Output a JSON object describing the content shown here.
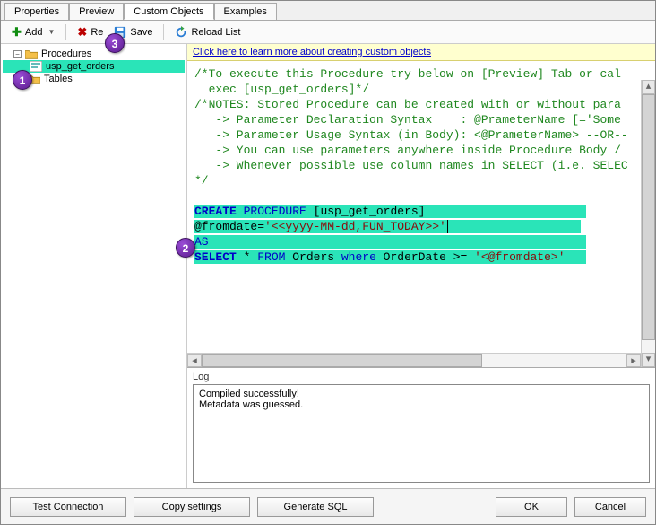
{
  "tabs": {
    "properties": "Properties",
    "preview": "Preview",
    "custom": "Custom Objects",
    "examples": "Examples"
  },
  "toolbar": {
    "add": "Add",
    "remove": "Re",
    "save": "Save",
    "reload": "Reload List"
  },
  "tree": {
    "procedures": "Procedures",
    "usp": "usp_get_orders",
    "tables": "Tables"
  },
  "hint": {
    "link": "Click here to learn more about creating custom objects"
  },
  "code": {
    "c1": "/*To execute this Procedure try below on [Preview] Tab or cal",
    "c2": "  exec [usp_get_orders]*/",
    "c3": "/*NOTES: Stored Procedure can be created with or without para",
    "c4": "   -> Parameter Declaration Syntax    : @PrameterName [='Some ",
    "c5": "   -> Parameter Usage Syntax (in Body): <@PrameterName> --OR--",
    "c6": "   -> You can use parameters anywhere inside Procedure Body / ",
    "c7": "   -> Whenever possible use column names in SELECT (i.e. SELEC",
    "c8": "*/",
    "createKw": "CREATE",
    "procKw": "PROCEDURE",
    "procName": "[usp_get_orders]",
    "fromdate": "@fromdate=",
    "fromdateStr": "'<<yyyy-MM-dd,FUN_TODAY>>'",
    "as": "AS",
    "select": "SELECT",
    "star": " * ",
    "from": "FROM",
    "orders": " Orders ",
    "where": "where",
    "rest": " OrderDate >= ",
    "rest2": "'<@fromdate>'"
  },
  "log": {
    "label": "Log",
    "line1": "Compiled successfully!",
    "line2": "Metadata was guessed."
  },
  "buttons": {
    "test": "Test Connection",
    "copy": "Copy settings",
    "gen": "Generate SQL",
    "ok": "OK",
    "cancel": "Cancel"
  },
  "callouts": {
    "1": "1",
    "2": "2",
    "3": "3"
  }
}
